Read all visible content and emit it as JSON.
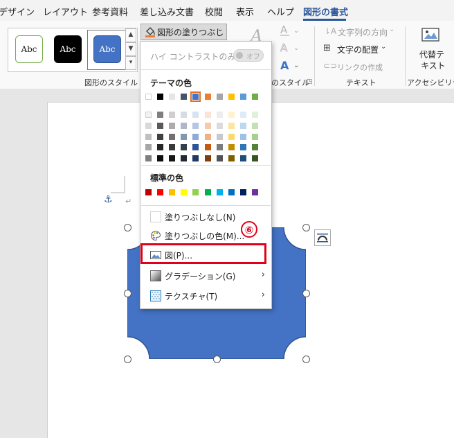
{
  "ribbon_tabs": [
    "デザイン",
    "レイアウト",
    "参考資料",
    "差し込み文書",
    "校閲",
    "表示",
    "ヘルプ",
    "図形の書式"
  ],
  "active_tab": "図形の書式",
  "shape_styles": {
    "thumb_label": "Abc",
    "group_label": "図形のスタイル",
    "partial_group_label": "のスタイル",
    "thumbs": [
      {
        "bg": "#ffffff",
        "border": "#70ad47",
        "text": "#222222"
      },
      {
        "bg": "#000000",
        "border": "#000000",
        "text": "#ffffff"
      },
      {
        "bg": "#4472c4",
        "border": "#2f5597",
        "text": "#ffffff"
      }
    ]
  },
  "fill_button": {
    "label": "図形の塗りつぶし",
    "accent": "#ed7d31"
  },
  "text_group": {
    "direction": "文字列の方向",
    "align": "文字の配置",
    "link": "リンクの作成",
    "label": "テキスト"
  },
  "accessibility": {
    "alt_text_line1": "代替テ",
    "alt_text_line2": "キスト",
    "label": "アクセシビリティ"
  },
  "fill_menu": {
    "high_contrast": "ハイ コントラストのみ(H)",
    "toggle": "オフ",
    "theme_colors_title": "テーマの色",
    "theme_colors": [
      [
        "#ffffff",
        "#f2f2f2",
        "#d9d9d9",
        "#bfbfbf",
        "#a6a6a6",
        "#7f7f7f"
      ],
      [
        "#000000",
        "#7f7f7f",
        "#595959",
        "#404040",
        "#262626",
        "#0d0d0d"
      ],
      [
        "#e7e6e6",
        "#d0cece",
        "#afabab",
        "#757070",
        "#3a3838",
        "#171616"
      ],
      [
        "#44546a",
        "#d6dce4",
        "#adb9ca",
        "#8497b0",
        "#333f4f",
        "#222a35"
      ],
      [
        "#4472c4",
        "#d9e2f3",
        "#b4c6e7",
        "#8eaadb",
        "#2f5496",
        "#1f3864"
      ],
      [
        "#ed7d31",
        "#fbe4d5",
        "#f7caac",
        "#f4b083",
        "#c55a11",
        "#833c0b"
      ],
      [
        "#a5a5a5",
        "#ededed",
        "#dbdbdb",
        "#c9c9c9",
        "#7b7b7b",
        "#525252"
      ],
      [
        "#ffc000",
        "#fff2cc",
        "#ffe599",
        "#ffd966",
        "#bf8f00",
        "#7f6000"
      ],
      [
        "#5b9bd5",
        "#deebf6",
        "#bdd7ee",
        "#9cc3e5",
        "#2e75b5",
        "#1f4e79"
      ],
      [
        "#70ad47",
        "#e2efd9",
        "#c5e0b3",
        "#a8d08d",
        "#538135",
        "#375623"
      ]
    ],
    "standard_colors_title": "標準の色",
    "standard_colors": [
      "#c00000",
      "#ff0000",
      "#ffc000",
      "#ffff00",
      "#92d050",
      "#00b050",
      "#00b0f0",
      "#0070c0",
      "#002060",
      "#7030a0"
    ],
    "no_fill": "塗りつぶしなし(N)",
    "more_colors": "塗りつぶしの色(M)...",
    "picture": "図(P)...",
    "gradient": "グラデーション(G)",
    "texture": "テクスチャ(T)",
    "submenu_arrow": "›"
  },
  "step_badge": "⑥",
  "shape": {
    "fill": "#4472c4",
    "stroke": "#2f528f"
  }
}
